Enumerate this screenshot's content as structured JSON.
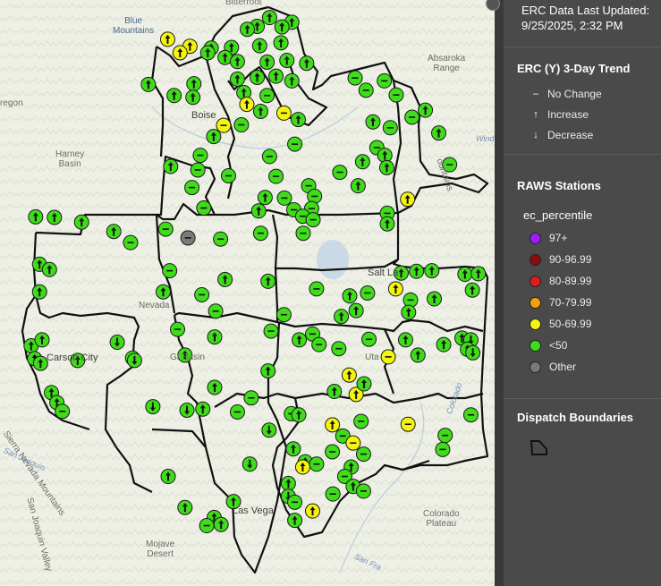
{
  "last_updated": {
    "line1": "ERC Data Last Updated:",
    "line2": "9/25/2025, 2:32 PM"
  },
  "trend_legend": {
    "title": "ERC (Y) 3-Day Trend",
    "items": [
      {
        "symbol": "–",
        "label": "No Change"
      },
      {
        "symbol": "↑",
        "label": "Increase"
      },
      {
        "symbol": "↓",
        "label": "Decrease"
      }
    ]
  },
  "raws_legend": {
    "title": "RAWS Stations",
    "field": "ec_percentile",
    "classes": [
      {
        "label": "97+",
        "color": "#9b1cff"
      },
      {
        "label": "90-96.99",
        "color": "#8b0c0c"
      },
      {
        "label": "80-89.99",
        "color": "#e01b1b"
      },
      {
        "label": "70-79.99",
        "color": "#f5a10a"
      },
      {
        "label": "50-69.99",
        "color": "#f4f40d"
      },
      {
        "label": "<50",
        "color": "#3fdc1a"
      },
      {
        "label": "Other",
        "color": "#7a7a7a"
      }
    ]
  },
  "dispatch_legend": {
    "title": "Dispatch Boundaries"
  },
  "place_labels": {
    "bitterroot": "Bitterroot",
    "blue_mountains": "Blue\nMountains",
    "absaroka": "Absaroka\nRange",
    "oregon": "regon",
    "boise": "Boise",
    "harney": "Harney\nBasin",
    "wind": "Wind",
    "mountains": "ountains",
    "salt_lake": "Salt La",
    "nevada": "Nevada",
    "carson": "Carson City",
    "great_basin": "Gr    Basin",
    "utah": "Uta",
    "colorado_river": "Colorado",
    "sierra": "Sierra Nevada Mountains",
    "san_joaquin_valley": "San Joaquin Valley",
    "san_joaquin": "San Joaquin",
    "las_vegas": "Las Vega",
    "mojave": "Mojave\nDesert",
    "colorado_plateau": "Colorado\nPlateau",
    "san_fran": "San Fra"
  },
  "stations": [
    {
      "lon": 0.545,
      "lat": 0.03,
      "level": "<50",
      "trend": "up"
    },
    {
      "lon": 0.59,
      "lat": 0.038,
      "level": "<50",
      "trend": "up"
    },
    {
      "lon": 0.52,
      "lat": 0.045,
      "level": "<50",
      "trend": "up"
    },
    {
      "lon": 0.57,
      "lat": 0.046,
      "level": "<50",
      "trend": "up"
    },
    {
      "lon": 0.5,
      "lat": 0.05,
      "level": "<50",
      "trend": "up"
    },
    {
      "lon": 0.339,
      "lat": 0.067,
      "level": "50-69.99",
      "trend": "up"
    },
    {
      "lon": 0.384,
      "lat": 0.079,
      "level": "50-69.99",
      "trend": "up"
    },
    {
      "lon": 0.364,
      "lat": 0.09,
      "level": "50-69.99",
      "trend": "up"
    },
    {
      "lon": 0.427,
      "lat": 0.082,
      "level": "<50",
      "trend": "up"
    },
    {
      "lon": 0.468,
      "lat": 0.081,
      "level": "<50",
      "trend": "up"
    },
    {
      "lon": 0.525,
      "lat": 0.078,
      "level": "<50",
      "trend": "up"
    },
    {
      "lon": 0.568,
      "lat": 0.073,
      "level": "<50",
      "trend": "up"
    },
    {
      "lon": 0.42,
      "lat": 0.09,
      "level": "<50",
      "trend": "up"
    },
    {
      "lon": 0.455,
      "lat": 0.098,
      "level": "<50",
      "trend": "up"
    },
    {
      "lon": 0.58,
      "lat": 0.103,
      "level": "<50",
      "trend": "up"
    },
    {
      "lon": 0.62,
      "lat": 0.108,
      "level": "<50",
      "trend": "up"
    },
    {
      "lon": 0.48,
      "lat": 0.105,
      "level": "<50",
      "trend": "up"
    },
    {
      "lon": 0.54,
      "lat": 0.106,
      "level": "<50",
      "trend": "up"
    },
    {
      "lon": 0.3,
      "lat": 0.144,
      "level": "<50",
      "trend": "up"
    },
    {
      "lon": 0.392,
      "lat": 0.143,
      "level": "<50",
      "trend": "up"
    },
    {
      "lon": 0.48,
      "lat": 0.135,
      "level": "<50",
      "trend": "up"
    },
    {
      "lon": 0.52,
      "lat": 0.132,
      "level": "<50",
      "trend": "up"
    },
    {
      "lon": 0.558,
      "lat": 0.13,
      "level": "<50",
      "trend": "up"
    },
    {
      "lon": 0.59,
      "lat": 0.138,
      "level": "<50",
      "trend": "up"
    },
    {
      "lon": 0.718,
      "lat": 0.133,
      "level": "<50",
      "trend": "none"
    },
    {
      "lon": 0.777,
      "lat": 0.138,
      "level": "<50",
      "trend": "none"
    },
    {
      "lon": 0.352,
      "lat": 0.163,
      "level": "<50",
      "trend": "up"
    },
    {
      "lon": 0.39,
      "lat": 0.166,
      "level": "<50",
      "trend": "up"
    },
    {
      "lon": 0.493,
      "lat": 0.158,
      "level": "<50",
      "trend": "up"
    },
    {
      "lon": 0.54,
      "lat": 0.163,
      "level": "<50",
      "trend": "none"
    },
    {
      "lon": 0.74,
      "lat": 0.154,
      "level": "<50",
      "trend": "none"
    },
    {
      "lon": 0.801,
      "lat": 0.162,
      "level": "<50",
      "trend": "none"
    },
    {
      "lon": 0.499,
      "lat": 0.178,
      "level": "50-69.99",
      "trend": "up"
    },
    {
      "lon": 0.527,
      "lat": 0.19,
      "level": "<50",
      "trend": "up"
    },
    {
      "lon": 0.574,
      "lat": 0.193,
      "level": "50-69.99",
      "trend": "none"
    },
    {
      "lon": 0.603,
      "lat": 0.204,
      "level": "<50",
      "trend": "up"
    },
    {
      "lon": 0.452,
      "lat": 0.214,
      "level": "50-69.99",
      "trend": "none"
    },
    {
      "lon": 0.488,
      "lat": 0.213,
      "level": "<50",
      "trend": "none"
    },
    {
      "lon": 0.86,
      "lat": 0.188,
      "level": "<50",
      "trend": "up"
    },
    {
      "lon": 0.833,
      "lat": 0.2,
      "level": "<50",
      "trend": "none"
    },
    {
      "lon": 0.754,
      "lat": 0.208,
      "level": "<50",
      "trend": "up"
    },
    {
      "lon": 0.789,
      "lat": 0.218,
      "level": "<50",
      "trend": "none"
    },
    {
      "lon": 0.432,
      "lat": 0.233,
      "level": "<50",
      "trend": "up"
    },
    {
      "lon": 0.596,
      "lat": 0.246,
      "level": "<50",
      "trend": "none"
    },
    {
      "lon": 0.887,
      "lat": 0.227,
      "level": "<50",
      "trend": "up"
    },
    {
      "lon": 0.762,
      "lat": 0.252,
      "level": "<50",
      "trend": "none"
    },
    {
      "lon": 0.405,
      "lat": 0.265,
      "level": "<50",
      "trend": "none"
    },
    {
      "lon": 0.545,
      "lat": 0.267,
      "level": "<50",
      "trend": "none"
    },
    {
      "lon": 0.778,
      "lat": 0.265,
      "level": "<50",
      "trend": "up"
    },
    {
      "lon": 0.733,
      "lat": 0.276,
      "level": "<50",
      "trend": "up"
    },
    {
      "lon": 0.782,
      "lat": 0.286,
      "level": "<50",
      "trend": "up"
    },
    {
      "lon": 0.345,
      "lat": 0.284,
      "level": "<50",
      "trend": "up"
    },
    {
      "lon": 0.4,
      "lat": 0.29,
      "level": "<50",
      "trend": "none"
    },
    {
      "lon": 0.687,
      "lat": 0.294,
      "level": "<50",
      "trend": "none"
    },
    {
      "lon": 0.909,
      "lat": 0.281,
      "level": "<50",
      "trend": "none"
    },
    {
      "lon": 0.462,
      "lat": 0.3,
      "level": "<50",
      "trend": "none"
    },
    {
      "lon": 0.558,
      "lat": 0.301,
      "level": "<50",
      "trend": "none"
    },
    {
      "lon": 0.388,
      "lat": 0.32,
      "level": "<50",
      "trend": "none"
    },
    {
      "lon": 0.624,
      "lat": 0.317,
      "level": "<50",
      "trend": "none"
    },
    {
      "lon": 0.724,
      "lat": 0.317,
      "level": "<50",
      "trend": "up"
    },
    {
      "lon": 0.575,
      "lat": 0.338,
      "level": "<50",
      "trend": "none"
    },
    {
      "lon": 0.536,
      "lat": 0.337,
      "level": "<50",
      "trend": "up"
    },
    {
      "lon": 0.636,
      "lat": 0.335,
      "level": "<50",
      "trend": "none"
    },
    {
      "lon": 0.824,
      "lat": 0.34,
      "level": "50-69.99",
      "trend": "up"
    },
    {
      "lon": 0.412,
      "lat": 0.355,
      "level": "<50",
      "trend": "none"
    },
    {
      "lon": 0.523,
      "lat": 0.36,
      "level": "<50",
      "trend": "up"
    },
    {
      "lon": 0.594,
      "lat": 0.358,
      "level": "<50",
      "trend": "none"
    },
    {
      "lon": 0.63,
      "lat": 0.356,
      "level": "<50",
      "trend": "none"
    },
    {
      "lon": 0.783,
      "lat": 0.364,
      "level": "<50",
      "trend": "none"
    },
    {
      "lon": 0.612,
      "lat": 0.369,
      "level": "<50",
      "trend": "none"
    },
    {
      "lon": 0.072,
      "lat": 0.37,
      "level": "<50",
      "trend": "up"
    },
    {
      "lon": 0.11,
      "lat": 0.371,
      "level": "<50",
      "trend": "up"
    },
    {
      "lon": 0.165,
      "lat": 0.379,
      "level": "<50",
      "trend": "up"
    },
    {
      "lon": 0.335,
      "lat": 0.391,
      "level": "<50",
      "trend": "none"
    },
    {
      "lon": 0.23,
      "lat": 0.395,
      "level": "<50",
      "trend": "up"
    },
    {
      "lon": 0.38,
      "lat": 0.406,
      "level": "Other",
      "trend": "none"
    },
    {
      "lon": 0.446,
      "lat": 0.408,
      "level": "<50",
      "trend": "none"
    },
    {
      "lon": 0.527,
      "lat": 0.398,
      "level": "<50",
      "trend": "none"
    },
    {
      "lon": 0.613,
      "lat": 0.398,
      "level": "<50",
      "trend": "none"
    },
    {
      "lon": 0.264,
      "lat": 0.414,
      "level": "<50",
      "trend": "none"
    },
    {
      "lon": 0.633,
      "lat": 0.375,
      "level": "<50",
      "trend": "none"
    },
    {
      "lon": 0.783,
      "lat": 0.382,
      "level": "<50",
      "trend": "up"
    },
    {
      "lon": 0.08,
      "lat": 0.451,
      "level": "<50",
      "trend": "up"
    },
    {
      "lon": 0.1,
      "lat": 0.46,
      "level": "<50",
      "trend": "up"
    },
    {
      "lon": 0.343,
      "lat": 0.462,
      "level": "<50",
      "trend": "none"
    },
    {
      "lon": 0.811,
      "lat": 0.466,
      "level": "<50",
      "trend": "up"
    },
    {
      "lon": 0.842,
      "lat": 0.463,
      "level": "<50",
      "trend": "up"
    },
    {
      "lon": 0.873,
      "lat": 0.462,
      "level": "<50",
      "trend": "up"
    },
    {
      "lon": 0.94,
      "lat": 0.468,
      "level": "<50",
      "trend": "up"
    },
    {
      "lon": 0.967,
      "lat": 0.467,
      "level": "<50",
      "trend": "up"
    },
    {
      "lon": 0.455,
      "lat": 0.477,
      "level": "<50",
      "trend": "up"
    },
    {
      "lon": 0.542,
      "lat": 0.48,
      "level": "<50",
      "trend": "up"
    },
    {
      "lon": 0.64,
      "lat": 0.493,
      "level": "<50",
      "trend": "none"
    },
    {
      "lon": 0.743,
      "lat": 0.5,
      "level": "<50",
      "trend": "none"
    },
    {
      "lon": 0.8,
      "lat": 0.493,
      "level": "50-69.99",
      "trend": "up"
    },
    {
      "lon": 0.955,
      "lat": 0.495,
      "level": "<50",
      "trend": "up"
    },
    {
      "lon": 0.08,
      "lat": 0.498,
      "level": "<50",
      "trend": "up"
    },
    {
      "lon": 0.33,
      "lat": 0.498,
      "level": "<50",
      "trend": "up"
    },
    {
      "lon": 0.408,
      "lat": 0.503,
      "level": "<50",
      "trend": "none"
    },
    {
      "lon": 0.707,
      "lat": 0.505,
      "level": "<50",
      "trend": "up"
    },
    {
      "lon": 0.83,
      "lat": 0.512,
      "level": "<50",
      "trend": "none"
    },
    {
      "lon": 0.878,
      "lat": 0.51,
      "level": "<50",
      "trend": "up"
    },
    {
      "lon": 0.436,
      "lat": 0.531,
      "level": "<50",
      "trend": "none"
    },
    {
      "lon": 0.574,
      "lat": 0.537,
      "level": "<50",
      "trend": "none"
    },
    {
      "lon": 0.69,
      "lat": 0.54,
      "level": "<50",
      "trend": "up"
    },
    {
      "lon": 0.72,
      "lat": 0.53,
      "level": "<50",
      "trend": "up"
    },
    {
      "lon": 0.826,
      "lat": 0.533,
      "level": "<50",
      "trend": "up"
    },
    {
      "lon": 0.359,
      "lat": 0.562,
      "level": "<50",
      "trend": "none"
    },
    {
      "lon": 0.434,
      "lat": 0.575,
      "level": "<50",
      "trend": "up"
    },
    {
      "lon": 0.548,
      "lat": 0.565,
      "level": "<50",
      "trend": "none"
    },
    {
      "lon": 0.632,
      "lat": 0.57,
      "level": "<50",
      "trend": "none"
    },
    {
      "lon": 0.746,
      "lat": 0.579,
      "level": "<50",
      "trend": "none"
    },
    {
      "lon": 0.82,
      "lat": 0.58,
      "level": "<50",
      "trend": "up"
    },
    {
      "lon": 0.934,
      "lat": 0.577,
      "level": "<50",
      "trend": "up"
    },
    {
      "lon": 0.952,
      "lat": 0.58,
      "level": "<50",
      "trend": "down"
    },
    {
      "lon": 0.063,
      "lat": 0.59,
      "level": "<50",
      "trend": "up"
    },
    {
      "lon": 0.085,
      "lat": 0.58,
      "level": "<50",
      "trend": "up"
    },
    {
      "lon": 0.237,
      "lat": 0.584,
      "level": "<50",
      "trend": "down"
    },
    {
      "lon": 0.605,
      "lat": 0.58,
      "level": "<50",
      "trend": "up"
    },
    {
      "lon": 0.645,
      "lat": 0.588,
      "level": "<50",
      "trend": "none"
    },
    {
      "lon": 0.685,
      "lat": 0.595,
      "level": "<50",
      "trend": "none"
    },
    {
      "lon": 0.897,
      "lat": 0.588,
      "level": "<50",
      "trend": "up"
    },
    {
      "lon": 0.945,
      "lat": 0.596,
      "level": "<50",
      "trend": "up"
    },
    {
      "lon": 0.956,
      "lat": 0.602,
      "level": "<50",
      "trend": "down"
    },
    {
      "lon": 0.07,
      "lat": 0.612,
      "level": "<50",
      "trend": "up"
    },
    {
      "lon": 0.157,
      "lat": 0.615,
      "level": "<50",
      "trend": "up"
    },
    {
      "lon": 0.268,
      "lat": 0.611,
      "level": "<50",
      "trend": "down"
    },
    {
      "lon": 0.374,
      "lat": 0.606,
      "level": "<50",
      "trend": "up"
    },
    {
      "lon": 0.785,
      "lat": 0.609,
      "level": "50-69.99",
      "trend": "none"
    },
    {
      "lon": 0.845,
      "lat": 0.606,
      "level": "<50",
      "trend": "up"
    },
    {
      "lon": 0.082,
      "lat": 0.62,
      "level": "<50",
      "trend": "up"
    },
    {
      "lon": 0.272,
      "lat": 0.615,
      "level": "<50",
      "trend": "down"
    },
    {
      "lon": 0.542,
      "lat": 0.633,
      "level": "<50",
      "trend": "up"
    },
    {
      "lon": 0.706,
      "lat": 0.64,
      "level": "50-69.99",
      "trend": "up"
    },
    {
      "lon": 0.434,
      "lat": 0.661,
      "level": "<50",
      "trend": "up"
    },
    {
      "lon": 0.676,
      "lat": 0.668,
      "level": "<50",
      "trend": "up"
    },
    {
      "lon": 0.72,
      "lat": 0.673,
      "level": "50-69.99",
      "trend": "up"
    },
    {
      "lon": 0.736,
      "lat": 0.655,
      "level": "<50",
      "trend": "up"
    },
    {
      "lon": 0.104,
      "lat": 0.67,
      "level": "<50",
      "trend": "up"
    },
    {
      "lon": 0.508,
      "lat": 0.679,
      "level": "<50",
      "trend": "none"
    },
    {
      "lon": 0.115,
      "lat": 0.687,
      "level": "<50",
      "trend": "up"
    },
    {
      "lon": 0.309,
      "lat": 0.694,
      "level": "<50",
      "trend": "down"
    },
    {
      "lon": 0.41,
      "lat": 0.698,
      "level": "<50",
      "trend": "up"
    },
    {
      "lon": 0.48,
      "lat": 0.703,
      "level": "<50",
      "trend": "none"
    },
    {
      "lon": 0.589,
      "lat": 0.706,
      "level": "<50",
      "trend": "none"
    },
    {
      "lon": 0.378,
      "lat": 0.7,
      "level": "<50",
      "trend": "down"
    },
    {
      "lon": 0.126,
      "lat": 0.702,
      "level": "<50",
      "trend": "none"
    },
    {
      "lon": 0.952,
      "lat": 0.708,
      "level": "<50",
      "trend": "none"
    },
    {
      "lon": 0.672,
      "lat": 0.725,
      "level": "50-69.99",
      "trend": "up"
    },
    {
      "lon": 0.73,
      "lat": 0.719,
      "level": "<50",
      "trend": "none"
    },
    {
      "lon": 0.825,
      "lat": 0.724,
      "level": "50-69.99",
      "trend": "none"
    },
    {
      "lon": 0.604,
      "lat": 0.708,
      "level": "<50",
      "trend": "up"
    },
    {
      "lon": 0.9,
      "lat": 0.743,
      "level": "<50",
      "trend": "none"
    },
    {
      "lon": 0.693,
      "lat": 0.744,
      "level": "<50",
      "trend": "none"
    },
    {
      "lon": 0.544,
      "lat": 0.734,
      "level": "<50",
      "trend": "down"
    },
    {
      "lon": 0.714,
      "lat": 0.756,
      "level": "50-69.99",
      "trend": "none"
    },
    {
      "lon": 0.593,
      "lat": 0.766,
      "level": "<50",
      "trend": "up"
    },
    {
      "lon": 0.672,
      "lat": 0.771,
      "level": "<50",
      "trend": "none"
    },
    {
      "lon": 0.735,
      "lat": 0.775,
      "level": "<50",
      "trend": "none"
    },
    {
      "lon": 0.895,
      "lat": 0.767,
      "level": "<50",
      "trend": "none"
    },
    {
      "lon": 0.617,
      "lat": 0.788,
      "level": "<50",
      "trend": "up"
    },
    {
      "lon": 0.64,
      "lat": 0.792,
      "level": "<50",
      "trend": "none"
    },
    {
      "lon": 0.612,
      "lat": 0.797,
      "level": "50-69.99",
      "trend": "up"
    },
    {
      "lon": 0.71,
      "lat": 0.797,
      "level": "<50",
      "trend": "up"
    },
    {
      "lon": 0.505,
      "lat": 0.792,
      "level": "<50",
      "trend": "down"
    },
    {
      "lon": 0.697,
      "lat": 0.813,
      "level": "<50",
      "trend": "none"
    },
    {
      "lon": 0.583,
      "lat": 0.825,
      "level": "<50",
      "trend": "up"
    },
    {
      "lon": 0.34,
      "lat": 0.813,
      "level": "<50",
      "trend": "up"
    },
    {
      "lon": 0.714,
      "lat": 0.83,
      "level": "<50",
      "trend": "up"
    },
    {
      "lon": 0.735,
      "lat": 0.838,
      "level": "<50",
      "trend": "none"
    },
    {
      "lon": 0.673,
      "lat": 0.843,
      "level": "<50",
      "trend": "none"
    },
    {
      "lon": 0.583,
      "lat": 0.847,
      "level": "<50",
      "trend": "down"
    },
    {
      "lon": 0.472,
      "lat": 0.856,
      "level": "<50",
      "trend": "up"
    },
    {
      "lon": 0.596,
      "lat": 0.857,
      "level": "<50",
      "trend": "none"
    },
    {
      "lon": 0.632,
      "lat": 0.872,
      "level": "50-69.99",
      "trend": "up"
    },
    {
      "lon": 0.374,
      "lat": 0.866,
      "level": "<50",
      "trend": "up"
    },
    {
      "lon": 0.433,
      "lat": 0.883,
      "level": "<50",
      "trend": "up"
    },
    {
      "lon": 0.447,
      "lat": 0.895,
      "level": "<50",
      "trend": "up"
    },
    {
      "lon": 0.596,
      "lat": 0.888,
      "level": "<50",
      "trend": "up"
    },
    {
      "lon": 0.418,
      "lat": 0.897,
      "level": "<50",
      "trend": "none"
    }
  ]
}
